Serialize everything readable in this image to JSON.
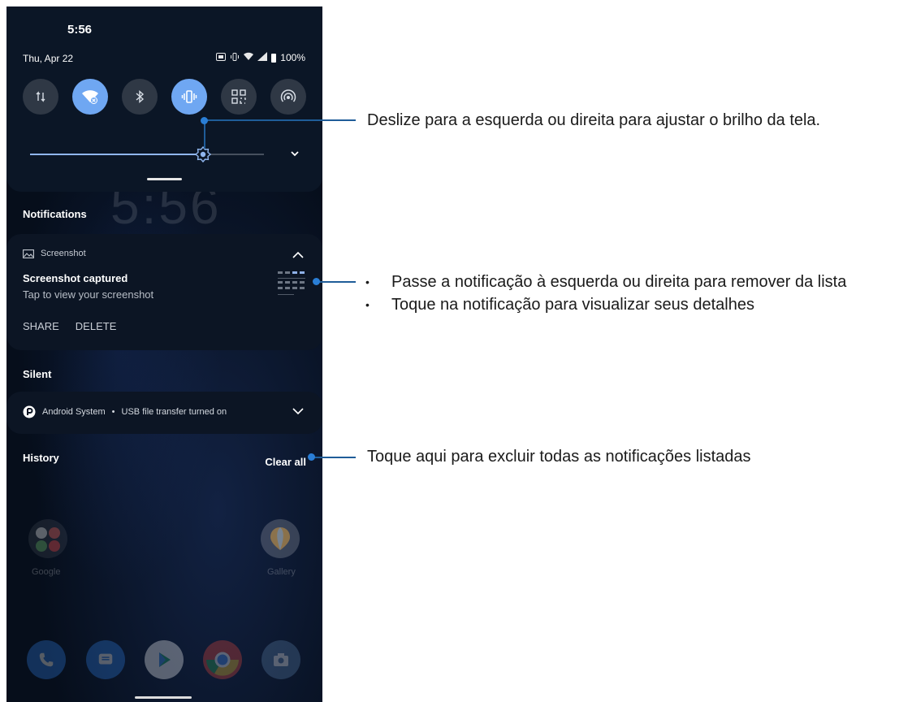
{
  "status_bar": {
    "time": "5:56",
    "date": "Thu, Apr 22",
    "battery": "100%"
  },
  "quick_settings": {
    "tiles": [
      {
        "name": "mobile-data-tile",
        "icon": "data-transfer-icon",
        "on": false
      },
      {
        "name": "wifi-tile",
        "icon": "wifi-icon",
        "on": true
      },
      {
        "name": "bluetooth-tile",
        "icon": "bluetooth-icon",
        "on": false
      },
      {
        "name": "vibrate-tile",
        "icon": "vibrate-icon",
        "on": true
      },
      {
        "name": "qr-scan-tile",
        "icon": "qr-code-icon",
        "on": false
      },
      {
        "name": "hotspot-tile",
        "icon": "hotspot-icon",
        "on": false
      }
    ],
    "brightness_level": 0.74,
    "accent_color": "#6fa7f2"
  },
  "lock_clock": "5:56",
  "notifications": {
    "section_label": "Notifications",
    "screenshot": {
      "app_name": "Screenshot",
      "title": "Screenshot captured",
      "text": "Tap to view your screenshot",
      "actions": [
        "SHARE",
        "DELETE"
      ]
    }
  },
  "silent": {
    "section_label": "Silent",
    "item": {
      "app_name": "Android System",
      "separator": "•",
      "text": "USB file transfer turned on"
    }
  },
  "history": {
    "label": "History",
    "clear_all": "Clear all"
  },
  "home_apps": [
    {
      "label": "Google"
    },
    {
      "label": "Gallery"
    }
  ],
  "callouts": {
    "brightness": "Deslize para a esquerda ou direita para ajustar o brilho da tela.",
    "notification_bullets": [
      "Passe a notificação à esquerda ou direita para remover da lista",
      "Toque na notificação para visualizar seus detalhes"
    ],
    "clear_all": "Toque aqui para excluir todas as notificações listadas",
    "line_color": "#1f5d99"
  }
}
